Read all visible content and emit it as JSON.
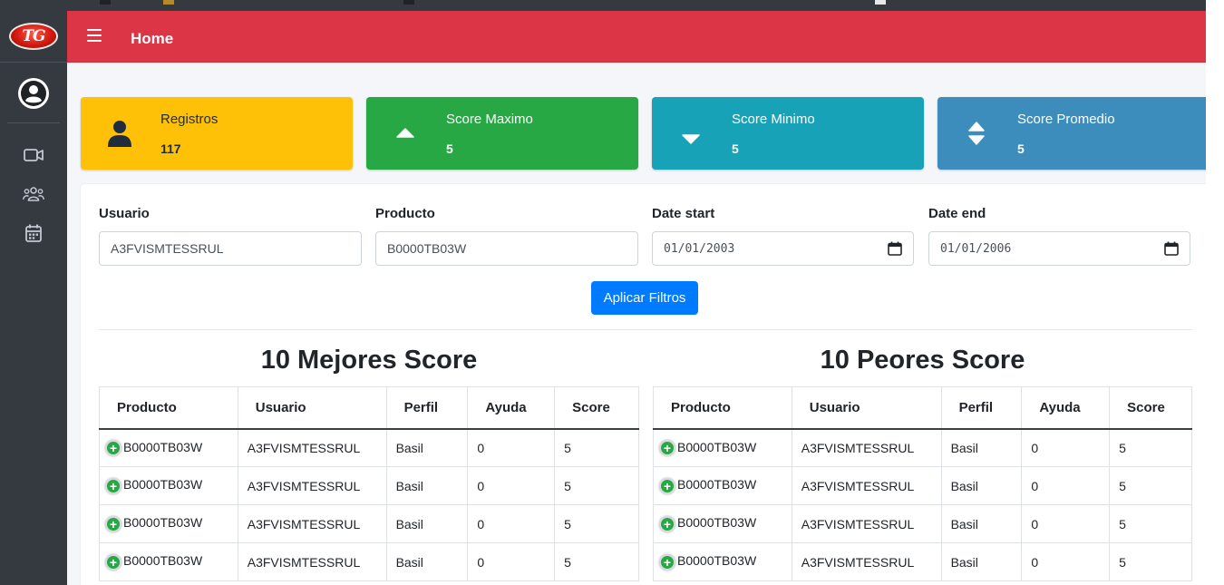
{
  "header": {
    "title": "Home"
  },
  "sidebar": {
    "items": [
      {
        "icon": "video-camera-icon"
      },
      {
        "icon": "users-icon"
      },
      {
        "icon": "calendar-icon"
      }
    ]
  },
  "stats": [
    {
      "label": "Registros",
      "value": "117",
      "icon": "user-icon",
      "color": "#ffc107"
    },
    {
      "label": "Score Maximo",
      "value": "5",
      "icon": "caret-up-icon",
      "color": "#28a745"
    },
    {
      "label": "Score Minimo",
      "value": "5",
      "icon": "caret-down-icon",
      "color": "#17a2b8"
    },
    {
      "label": "Score Promedio",
      "value": "5",
      "icon": "sort-icon",
      "color": "#3c8dbc"
    }
  ],
  "filters": {
    "usuario": {
      "label": "Usuario",
      "value": "A3FVISMTESSRUL"
    },
    "producto": {
      "label": "Producto",
      "value": "B0000TB03W"
    },
    "date_start": {
      "label": "Date start",
      "value": "01/01/2003"
    },
    "date_end": {
      "label": "Date end",
      "value": "01/01/2006"
    },
    "apply_label": "Aplicar Filtros"
  },
  "best": {
    "title": "10 Mejores Score",
    "columns": [
      "Producto",
      "Usuario",
      "Perfil",
      "Ayuda",
      "Score"
    ],
    "rows": [
      [
        "B0000TB03W",
        "A3FVISMTESSRUL",
        "Basil",
        "0",
        "5"
      ],
      [
        "B0000TB03W",
        "A3FVISMTESSRUL",
        "Basil",
        "0",
        "5"
      ],
      [
        "B0000TB03W",
        "A3FVISMTESSRUL",
        "Basil",
        "0",
        "5"
      ],
      [
        "B0000TB03W",
        "A3FVISMTESSRUL",
        "Basil",
        "0",
        "5"
      ]
    ]
  },
  "worst": {
    "title": "10 Peores Score",
    "columns": [
      "Producto",
      "Usuario",
      "Perfil",
      "Ayuda",
      "Score"
    ],
    "rows": [
      [
        "B0000TB03W",
        "A3FVISMTESSRUL",
        "Basil",
        "0",
        "5"
      ],
      [
        "B0000TB03W",
        "A3FVISMTESSRUL",
        "Basil",
        "0",
        "5"
      ],
      [
        "B0000TB03W",
        "A3FVISMTESSRUL",
        "Basil",
        "0",
        "5"
      ],
      [
        "B0000TB03W",
        "A3FVISMTESSRUL",
        "Basil",
        "0",
        "5"
      ]
    ]
  }
}
